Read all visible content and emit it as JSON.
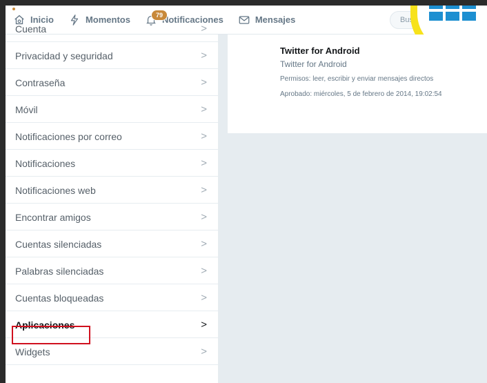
{
  "nav": {
    "home": "Inicio",
    "moments": "Momentos",
    "notifications": "Notificaciones",
    "notifications_badge": "79",
    "messages": "Mensajes",
    "search_placeholder": "Bus"
  },
  "menu": {
    "items": [
      {
        "label": "Cuenta"
      },
      {
        "label": "Privacidad y seguridad"
      },
      {
        "label": "Contraseña"
      },
      {
        "label": "Móvil"
      },
      {
        "label": "Notificaciones por correo"
      },
      {
        "label": "Notificaciones"
      },
      {
        "label": "Notificaciones web"
      },
      {
        "label": "Encontrar amigos"
      },
      {
        "label": "Cuentas silenciadas"
      },
      {
        "label": "Palabras silenciadas"
      },
      {
        "label": "Cuentas bloqueadas"
      },
      {
        "label": "Aplicaciones"
      },
      {
        "label": "Widgets"
      }
    ],
    "chevron": ">"
  },
  "app": {
    "name": "Twitter for Android",
    "subtitle": "Twitter for Android",
    "permissions": "Permisos: leer, escribir y enviar mensajes directos",
    "approved": "Aprobado: miércoles, 5 de febrero de 2014, 19:02:54"
  },
  "colors": {
    "accent": "#1d8fd1",
    "badge": "#c8893a",
    "highlight": "#d0101e",
    "apps_ring": "#f7e21b"
  },
  "icons": [
    "home-icon",
    "lightning-icon",
    "bell-icon",
    "envelope-icon",
    "grid-icon"
  ]
}
